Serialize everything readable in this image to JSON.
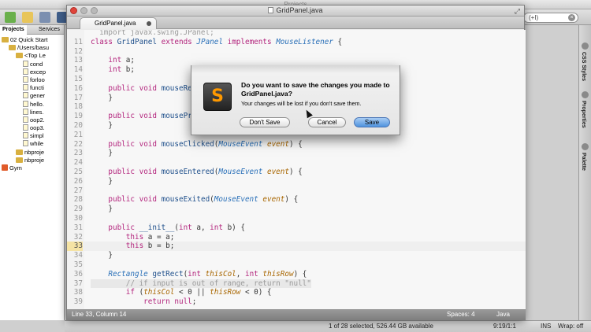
{
  "ide": {
    "window_title": "Projects",
    "search_value": "(+I)",
    "status_count": "1 of 28 selected, 526.44 GB available",
    "position": "9:19/1:1",
    "mode": "INS",
    "wrap": "Wrap: off"
  },
  "projects_panel": {
    "tabs": [
      "Projects",
      "Services"
    ],
    "tree": [
      {
        "label": "02 Quick Start",
        "kind": "project",
        "indent": 0
      },
      {
        "label": "/Users/basu",
        "kind": "folder",
        "indent": 1
      },
      {
        "label": "<Top Le",
        "kind": "folder",
        "indent": 2
      },
      {
        "label": "cond",
        "kind": "file",
        "indent": 3
      },
      {
        "label": "excep",
        "kind": "file",
        "indent": 3
      },
      {
        "label": "forloo",
        "kind": "file",
        "indent": 3
      },
      {
        "label": "functi",
        "kind": "file",
        "indent": 3
      },
      {
        "label": "gener",
        "kind": "file",
        "indent": 3
      },
      {
        "label": "hello.",
        "kind": "file",
        "indent": 3
      },
      {
        "label": "lines.",
        "kind": "file",
        "indent": 3
      },
      {
        "label": "oop2.",
        "kind": "file",
        "indent": 3
      },
      {
        "label": "oop3.",
        "kind": "file",
        "indent": 3
      },
      {
        "label": "simpl",
        "kind": "file",
        "indent": 3
      },
      {
        "label": "while",
        "kind": "file",
        "indent": 3
      },
      {
        "label": "nbproje",
        "kind": "folder",
        "indent": 2
      },
      {
        "label": "nbproje",
        "kind": "folder",
        "indent": 2
      },
      {
        "label": "Gym",
        "kind": "gym",
        "indent": 0
      }
    ]
  },
  "right_strip": {
    "labels": [
      "CSS Styles",
      "Properties",
      "Palette"
    ]
  },
  "editor": {
    "window_title": "GridPanel.java",
    "tab_label": "GridPanel.java",
    "status_left": "Line 33, Column 14",
    "spaces": "Spaces: 4",
    "language": "Java",
    "lines": [
      {
        "n": "",
        "t": "  import javax.swing.JPanel;",
        "s": "cm"
      },
      {
        "n": "11",
        "t": "class GridPanel extends JPanel implements MouseListener {"
      },
      {
        "n": "12",
        "t": ""
      },
      {
        "n": "13",
        "t": "    int a;"
      },
      {
        "n": "14",
        "t": "    int b;"
      },
      {
        "n": "15",
        "t": ""
      },
      {
        "n": "16",
        "t": "    public void mouseReleased(MouseEvent event) {"
      },
      {
        "n": "17",
        "t": "    }"
      },
      {
        "n": "18",
        "t": ""
      },
      {
        "n": "19",
        "t": "    public void mousePressed(MouseEvent event) {"
      },
      {
        "n": "20",
        "t": "    }"
      },
      {
        "n": "21",
        "t": ""
      },
      {
        "n": "22",
        "t": "    public void mouseClicked(MouseEvent event) {"
      },
      {
        "n": "23",
        "t": "    }"
      },
      {
        "n": "24",
        "t": ""
      },
      {
        "n": "25",
        "t": "    public void mouseEntered(MouseEvent event) {"
      },
      {
        "n": "26",
        "t": "    }"
      },
      {
        "n": "27",
        "t": ""
      },
      {
        "n": "28",
        "t": "    public void mouseExited(MouseEvent event) {"
      },
      {
        "n": "29",
        "t": "    }"
      },
      {
        "n": "30",
        "t": ""
      },
      {
        "n": "31",
        "t": "    public __init__(int a, int b) {"
      },
      {
        "n": "32",
        "t": "        this a = a;"
      },
      {
        "n": "33",
        "t": "        this b = b;",
        "cur": true
      },
      {
        "n": "34",
        "t": "    }"
      },
      {
        "n": "35",
        "t": ""
      },
      {
        "n": "36",
        "t": "    Rectangle getRect(int thisCol, int thisRow) {"
      },
      {
        "n": "37",
        "t": "        // if input is out of range, return \"null\"",
        "hl": true
      },
      {
        "n": "38",
        "t": "        if (thisCol < 0 || thisRow < 0) {"
      },
      {
        "n": "39",
        "t": "            return null;"
      }
    ]
  },
  "dialog": {
    "title": "Do you want to save the changes you made to GridPanel.java?",
    "message": "Your changes will be lost if you don't save them.",
    "buttons": {
      "dont_save": "Don't Save",
      "cancel": "Cancel",
      "save": "Save"
    },
    "icon_letter": "S"
  },
  "colors": {
    "save_button": "#4f93de",
    "close_light": "#e0443b",
    "icon_accent": "#ff9900"
  }
}
